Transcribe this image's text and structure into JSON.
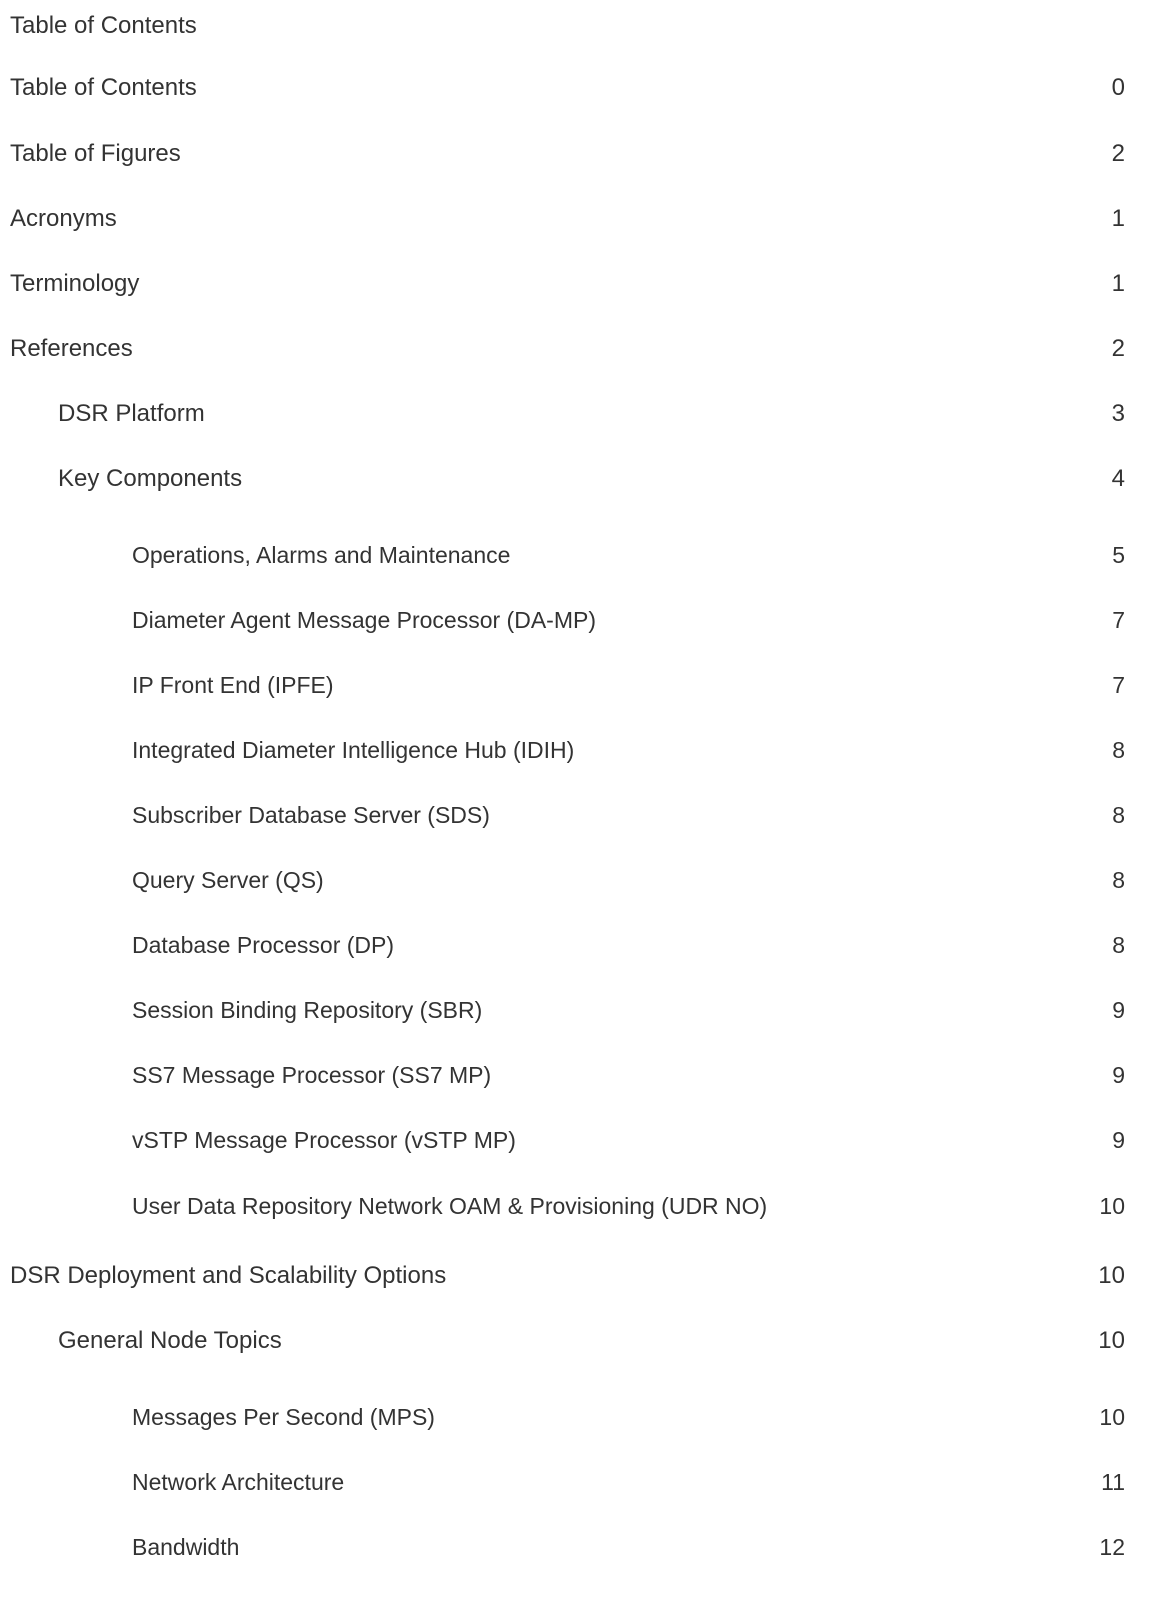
{
  "heading": "Table of Contents",
  "entries": [
    {
      "title": "Table of Contents",
      "page": "0"
    },
    {
      "title": "Table of Figures",
      "page": "2"
    },
    {
      "title": "Acronyms",
      "page": "1"
    },
    {
      "title": "Terminology",
      "page": "1"
    },
    {
      "title": "References",
      "page": "2"
    },
    {
      "title": "DSR Platform",
      "page": "3"
    },
    {
      "title": "Key Components",
      "page": "4"
    },
    {
      "title": "Operations, Alarms and Maintenance",
      "page": "5"
    },
    {
      "title": "Diameter Agent Message Processor (DA-MP)",
      "page": "7"
    },
    {
      "title": "IP Front End (IPFE)",
      "page": "7"
    },
    {
      "title": "Integrated Diameter Intelligence Hub (IDIH)",
      "page": "8"
    },
    {
      "title": "Subscriber Database Server (SDS)",
      "page": "8"
    },
    {
      "title": "Query Server (QS)",
      "page": "8"
    },
    {
      "title": "Database Processor (DP)",
      "page": "8"
    },
    {
      "title": "Session Binding Repository (SBR)",
      "page": "9"
    },
    {
      "title": "SS7 Message Processor (SS7 MP)",
      "page": "9"
    },
    {
      "title": "vSTP Message Processor (vSTP MP)",
      "page": "9"
    },
    {
      "title": "User Data Repository Network OAM & Provisioning (UDR NO)",
      "page": "10"
    },
    {
      "title": "DSR Deployment and Scalability Options",
      "page": "10"
    },
    {
      "title": "General Node Topics",
      "page": "10"
    },
    {
      "title": "Messages Per Second (MPS)",
      "page": "10"
    },
    {
      "title": "Network Architecture",
      "page": "11"
    },
    {
      "title": "Bandwidth",
      "page": "12"
    }
  ]
}
